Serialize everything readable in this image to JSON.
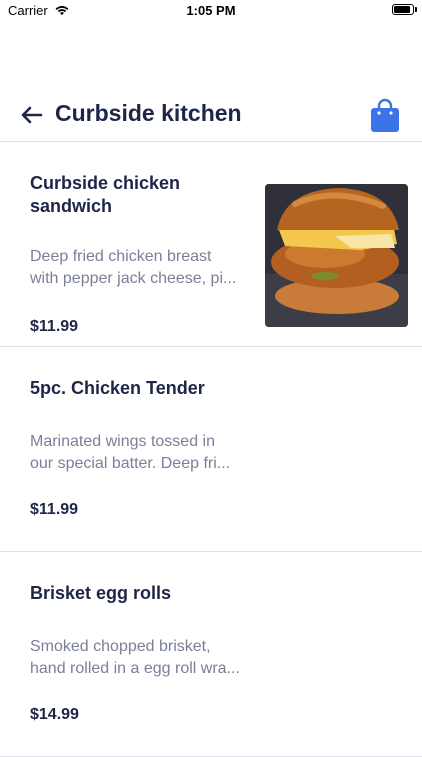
{
  "status": {
    "carrier": "Carrier",
    "time": "1:05 PM"
  },
  "header": {
    "title": "Curbside kitchen"
  },
  "items": [
    {
      "name": "Curbside chicken sandwich",
      "desc_line1": "Deep fried chicken breast",
      "desc_line2": "with pepper jack cheese, pi...",
      "price": "$11.99",
      "image": "chicken-sandwich-photo"
    },
    {
      "name": "5pc. Chicken Tender",
      "desc_line1": "Marinated wings tossed in",
      "desc_line2": "our special batter. Deep fri...",
      "price": "$11.99"
    },
    {
      "name": "Brisket egg rolls",
      "desc_line1": "Smoked chopped brisket,",
      "desc_line2": "hand rolled in a egg roll wra...",
      "price": "$14.99"
    }
  ],
  "colors": {
    "accent": "#3d73e8",
    "title": "#1f2547",
    "muted": "#7b7f98",
    "divider": "#e2e2e6"
  }
}
